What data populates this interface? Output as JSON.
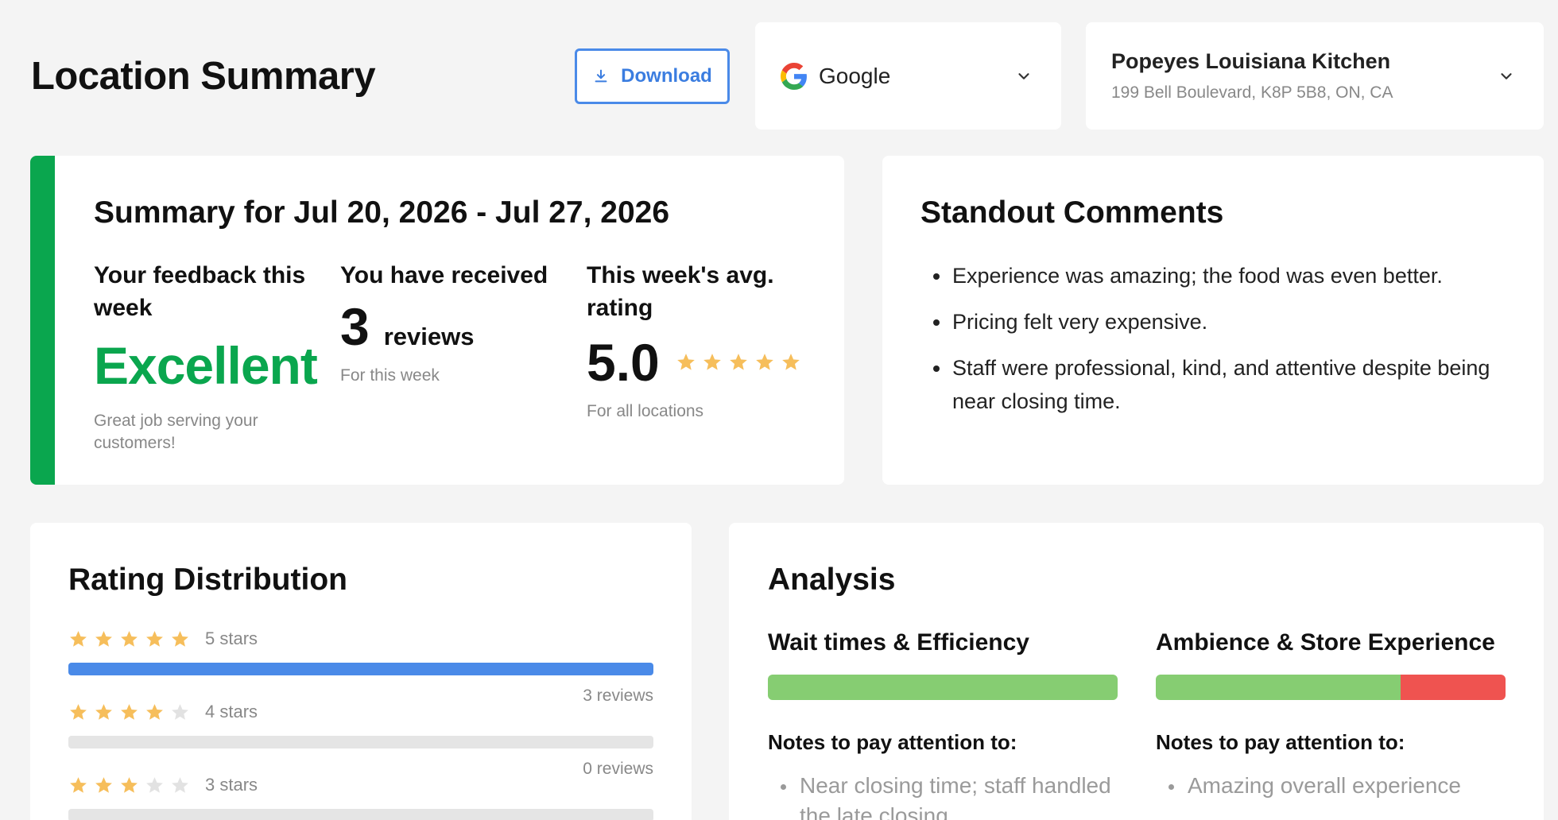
{
  "header": {
    "title": "Location Summary",
    "download_label": "Download",
    "source": {
      "label": "Google",
      "icon": "google-logo-icon"
    },
    "location": {
      "name": "Popeyes Louisiana Kitchen",
      "address": "199 Bell Boulevard, K8P 5B8, ON, CA"
    }
  },
  "summary": {
    "title": "Summary for Jul 20, 2026 - Jul 27, 2026",
    "accent_color": "#0aa64e",
    "feedback": {
      "heading": "Your feedback this week",
      "value": "Excellent",
      "note": "Great job serving your customers!"
    },
    "received": {
      "heading": "You have received",
      "count": "3",
      "unit": "reviews",
      "note": "For this week"
    },
    "avg_rating": {
      "heading": "This week's avg. rating",
      "value": "5.0",
      "stars": 5,
      "note": "For all locations"
    }
  },
  "standout": {
    "title": "Standout Comments",
    "comments": [
      "Experience was amazing; the food was even better.",
      "Pricing felt very expensive.",
      "Staff were professional, kind, and attentive despite being near closing time."
    ]
  },
  "distribution": {
    "title": "Rating Distribution",
    "bar_color": "#4a8ae8",
    "rows": [
      {
        "stars": 5,
        "label": "5 stars",
        "fraction": 1.0,
        "reviews": "3 reviews"
      },
      {
        "stars": 4,
        "label": "4 stars",
        "fraction": 0.0,
        "reviews": "0 reviews"
      },
      {
        "stars": 3,
        "label": "3 stars",
        "fraction": 0.0,
        "reviews": ""
      }
    ]
  },
  "analysis": {
    "title": "Analysis",
    "positive_color": "#86cd72",
    "negative_color": "#ef5350",
    "categories": [
      {
        "heading": "Wait times & Efficiency",
        "positive_fraction": 1.0,
        "notes_heading": "Notes to pay attention to:",
        "notes": [
          "Near closing time; staff handled the late closing"
        ]
      },
      {
        "heading": "Ambience & Store Experience",
        "positive_fraction": 0.7,
        "notes_heading": "Notes to pay attention to:",
        "notes": [
          "Amazing overall experience"
        ]
      }
    ]
  }
}
